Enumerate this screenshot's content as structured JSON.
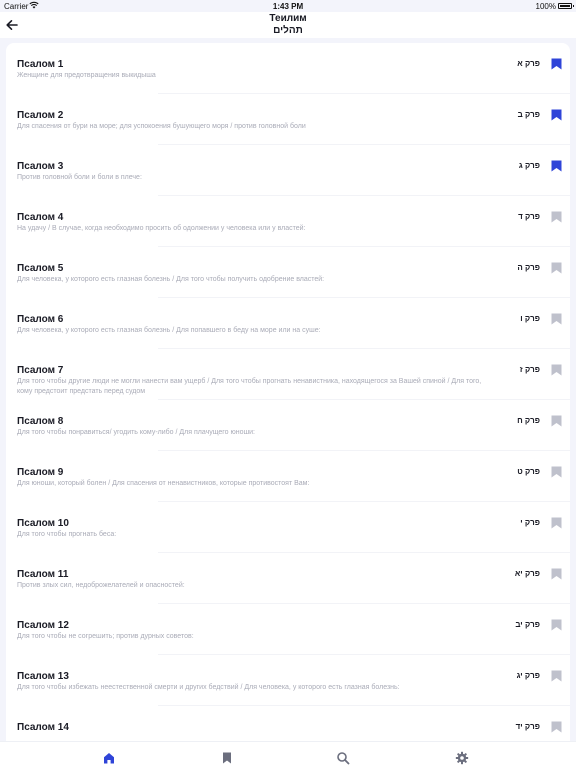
{
  "status_bar": {
    "carrier": "Carrier",
    "time": "1:43 PM",
    "battery": "100%"
  },
  "header": {
    "title": "Теилим",
    "subtitle": "תהלים"
  },
  "colors": {
    "accent": "#2f44d8",
    "bookmark_inactive": "#bfc1cc"
  },
  "psalms": [
    {
      "name": "Псалом 1",
      "desc": "Женщине для предотвращения выкидыша",
      "perek": "פרק א",
      "bookmarked": true
    },
    {
      "name": "Псалом 2",
      "desc": "Для спасения от бури на море; для успокоения бушующего моря / против головной боли",
      "perek": "פרק ב",
      "bookmarked": true
    },
    {
      "name": "Псалом 3",
      "desc": "Против головной боли и боли в плече:",
      "perek": "פרק ג",
      "bookmarked": true
    },
    {
      "name": "Псалом 4",
      "desc": "На удачу / В случае, когда необходимо просить об одолжении у человека или у властей:",
      "perek": "פרק ד",
      "bookmarked": false
    },
    {
      "name": "Псалом 5",
      "desc": "Для человека, у которого есть глазная болезнь / Для того чтобы получить одобрение властей:",
      "perek": "פרק ה",
      "bookmarked": false
    },
    {
      "name": "Псалом 6",
      "desc": "Для человека, у которого есть глазная болезнь / Для попавшего в беду на море или на суше:",
      "perek": "פרק ו",
      "bookmarked": false
    },
    {
      "name": "Псалом 7",
      "desc": "Для того чтобы другие люди не могли нанести вам ущерб / Для того чтобы прогнать ненавистника, находящегося за Вашей спиной / Для того, кому предстоит предстать перед судом",
      "perek": "פרק ז",
      "bookmarked": false
    },
    {
      "name": "Псалом 8",
      "desc": "Для того чтобы понравиться/ угодить кому-либо / Для плачущего юноши:",
      "perek": "פרק ח",
      "bookmarked": false
    },
    {
      "name": "Псалом 9",
      "desc": "Для юноши, который болен / Для спасения от ненавистников, которые противостоят Вам:",
      "perek": "פרק ט",
      "bookmarked": false
    },
    {
      "name": "Псалом 10",
      "desc": "Для того чтобы прогнать беса:",
      "perek": "פרק י",
      "bookmarked": false
    },
    {
      "name": "Псалом 11",
      "desc": "Против злых сил, недоброжелателей и опасностей:",
      "perek": "פרק יא",
      "bookmarked": false
    },
    {
      "name": "Псалом 12",
      "desc": "Для того чтобы не согрешить; против дурных советов:",
      "perek": "פרק יב",
      "bookmarked": false
    },
    {
      "name": "Псалом 13",
      "desc": "Для того чтобы избежать неестественной смерти и других бедствий / Для человека, у которого есть глазная болезнь:",
      "perek": "פרק יג",
      "bookmarked": false
    },
    {
      "name": "Псалом 14",
      "desc": "",
      "perek": "פרק יד",
      "bookmarked": false
    }
  ],
  "tabbar": {
    "items": [
      {
        "icon": "home-icon",
        "active": true
      },
      {
        "icon": "bookmark-icon",
        "active": false
      },
      {
        "icon": "search-icon",
        "active": false
      },
      {
        "icon": "gear-icon",
        "active": false
      }
    ]
  }
}
